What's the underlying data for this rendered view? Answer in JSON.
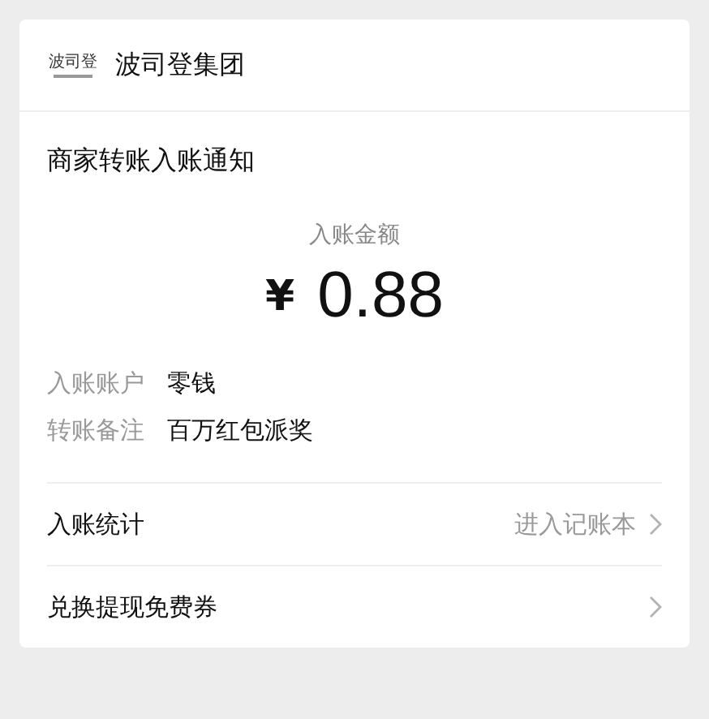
{
  "header": {
    "logo_text": "波司登",
    "account_name": "波司登集团"
  },
  "title": "商家转账入账通知",
  "amount": {
    "label": "入账金额",
    "currency": "¥",
    "value": "0.88"
  },
  "details": [
    {
      "label": "入账账户",
      "value": "零钱"
    },
    {
      "label": "转账备注",
      "value": "百万红包派奖"
    }
  ],
  "links": [
    {
      "label": "入账统计",
      "hint": "进入记账本"
    },
    {
      "label": "兑换提现免费券"
    }
  ]
}
